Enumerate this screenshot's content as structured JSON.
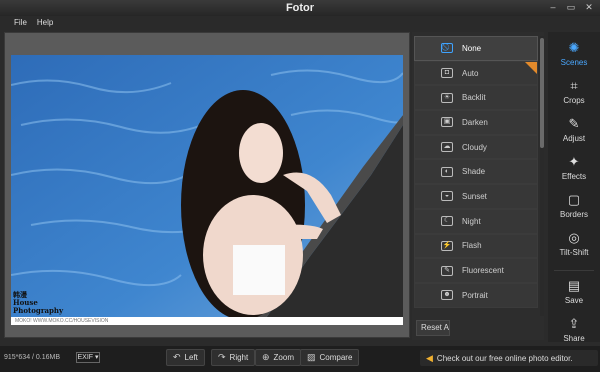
{
  "window": {
    "title": "Fotor",
    "controls": [
      "–",
      "▭",
      "✕"
    ]
  },
  "menu": [
    "File",
    "Help"
  ],
  "photo": {
    "watermark_line1": "韩漫",
    "watermark_line2": "House",
    "watermark_line3": "Photography",
    "caption": "MOKO! WWW.MOKO.CC/HOUSEVISION"
  },
  "scenes": {
    "items": [
      {
        "label": "None",
        "icon": "⃠",
        "active": true
      },
      {
        "label": "Auto",
        "icon": "◘"
      },
      {
        "label": "Backlit",
        "icon": "☀"
      },
      {
        "label": "Darken",
        "icon": "▣"
      },
      {
        "label": "Cloudy",
        "icon": "☁"
      },
      {
        "label": "Shade",
        "icon": "◐"
      },
      {
        "label": "Sunset",
        "icon": "◒"
      },
      {
        "label": "Night",
        "icon": "☾"
      },
      {
        "label": "Flash",
        "icon": "⚡"
      },
      {
        "label": "Fluorescent",
        "icon": "✎"
      },
      {
        "label": "Portrait",
        "icon": "☻"
      }
    ],
    "reset_label": "Reset All"
  },
  "tools": [
    {
      "label": "Scenes",
      "icon": "✺",
      "active": true
    },
    {
      "label": "Crops",
      "icon": "⌗"
    },
    {
      "label": "Adjust",
      "icon": "✎"
    },
    {
      "label": "Effects",
      "icon": "✦"
    },
    {
      "label": "Borders",
      "icon": "▢"
    },
    {
      "label": "Tilt-Shift",
      "icon": "◎"
    },
    {
      "label": "Save",
      "icon": "▤"
    },
    {
      "label": "Share",
      "icon": "⇪"
    }
  ],
  "status": {
    "info": "915*634 / 0.16MB",
    "exif_label": "EXIF ▾",
    "buttons": [
      {
        "label": "Left",
        "icon": "↶"
      },
      {
        "label": "Right",
        "icon": "↷"
      },
      {
        "label": "Zoom",
        "icon": "⊕"
      },
      {
        "label": "Compare",
        "icon": "▨"
      }
    ],
    "promo_text": "Check out our free online photo editor."
  },
  "colors": {
    "accent": "#4aa8ff",
    "pro_badge": "#e38a2b"
  }
}
